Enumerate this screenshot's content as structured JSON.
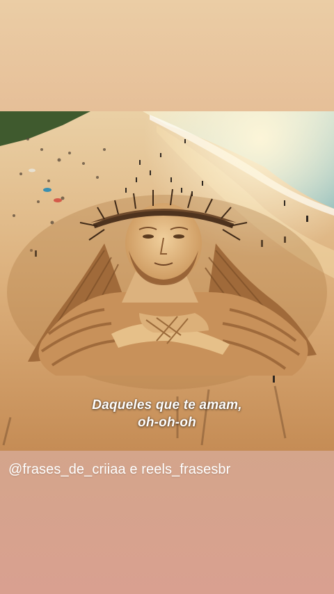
{
  "story": {
    "caption_line_1": "Daqueles que te amam,",
    "caption_line_2": "oh-oh-oh",
    "mention_text": "@frases_de_criiaa e reels_frasesbr"
  },
  "colors": {
    "top_background": "#e8c9a3",
    "bottom_background": "#d7a08b",
    "sand": "#ddb07c",
    "sea": "#9fc7c4",
    "text": "#ffffff"
  },
  "image": {
    "subject": "sand-sculpture-jesus-on-beach"
  }
}
